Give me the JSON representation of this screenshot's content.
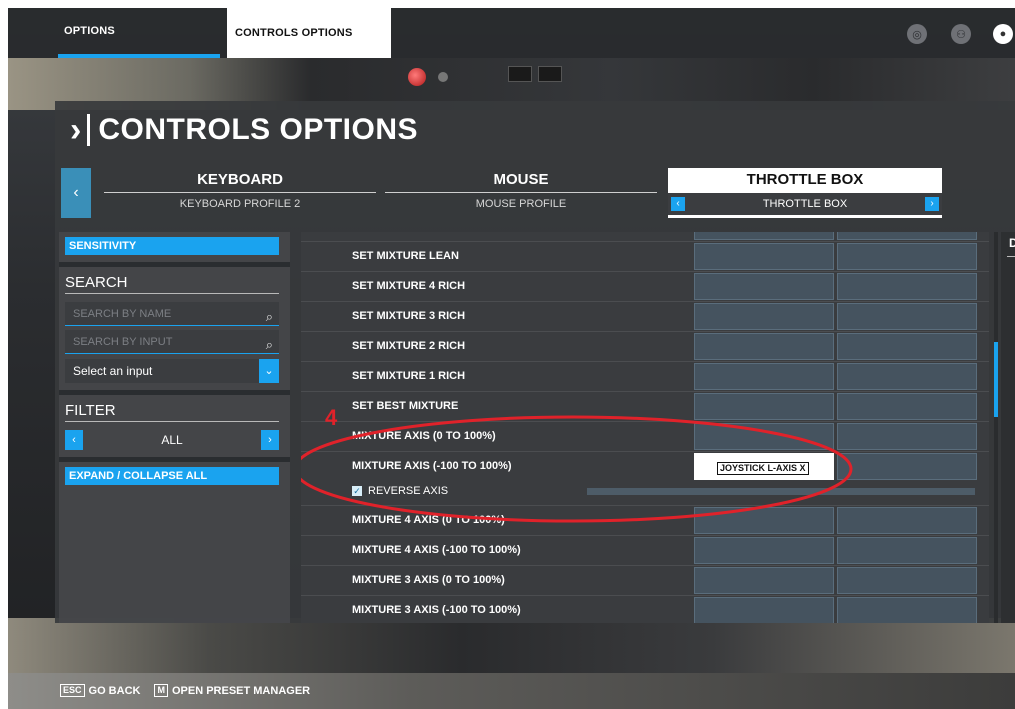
{
  "nav": {
    "tab_options": "OPTIONS",
    "tab_controls": "CONTROLS OPTIONS"
  },
  "page": {
    "title": "CONTROLS OPTIONS"
  },
  "devices": [
    {
      "name": "KEYBOARD",
      "profile": "KEYBOARD PROFILE 2"
    },
    {
      "name": "MOUSE",
      "profile": "MOUSE PROFILE"
    },
    {
      "name": "THROTTLE BOX",
      "profile": "THROTTLE BOX"
    }
  ],
  "sidebar": {
    "sensitivity": "SENSITIVITY",
    "search_label": "SEARCH",
    "search_by_name_placeholder": "SEARCH BY NAME",
    "search_by_input_placeholder": "SEARCH BY INPUT",
    "select_input": "Select an input",
    "filter_label": "FILTER",
    "filter_value": "ALL",
    "expand_collapse": "EXPAND / COLLAPSE ALL"
  },
  "list": {
    "rows": [
      "SET MIXTURE LEAN",
      "SET MIXTURE 4 RICH",
      "SET MIXTURE 3 RICH",
      "SET MIXTURE 2 RICH",
      "SET MIXTURE 1 RICH",
      "SET BEST MIXTURE",
      "MIXTURE AXIS (0 TO 100%)",
      "MIXTURE AXIS (-100 TO 100%)",
      "MIXTURE 4 AXIS (0 TO 100%)",
      "MIXTURE 4 AXIS (-100 TO 100%)",
      "MIXTURE 3 AXIS (0 TO 100%)",
      "MIXTURE 3 AXIS (-100 TO 100%)"
    ],
    "binding": "JOYSTICK L-AXIS X",
    "reverse_axis": "REVERSE AXIS",
    "reverse_checked": true
  },
  "right_column_letter": "D",
  "annotation": {
    "number": "4"
  },
  "footer": {
    "go_back_key": "ESC",
    "go_back": "GO BACK",
    "preset_key": "M",
    "preset": "OPEN PRESET MANAGER"
  },
  "colors": {
    "accent": "#1aa3ef",
    "annotation": "#e0222a"
  }
}
